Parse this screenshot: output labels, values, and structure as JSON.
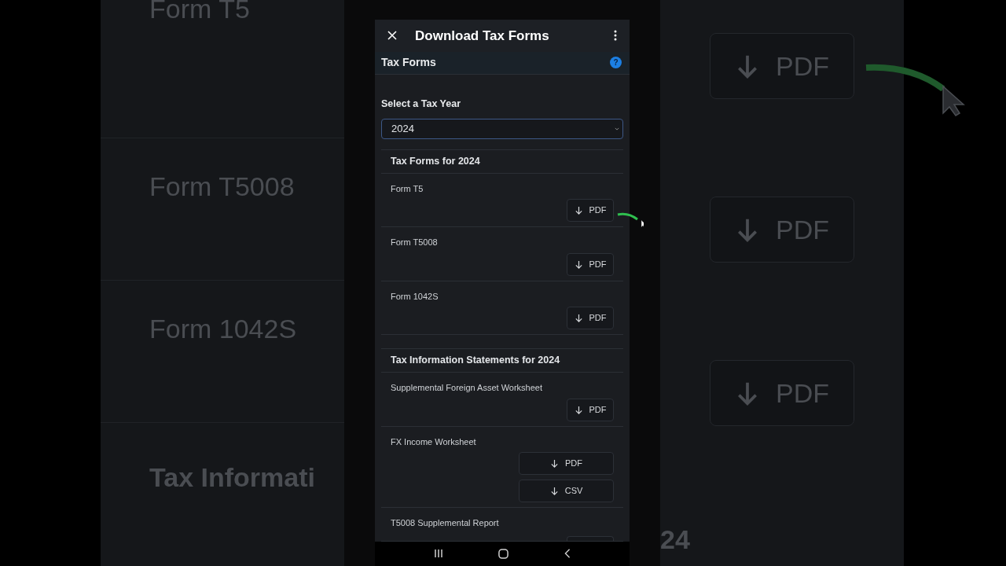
{
  "backdrop": {
    "left_texts": [
      "Form T5",
      "Form T5008",
      "Form 1042S",
      "Tax Informati"
    ],
    "right_buttons": [
      "PDF",
      "PDF",
      "PDF"
    ],
    "right_text": "24"
  },
  "header": {
    "title": "Download Tax Forms"
  },
  "section_bar": {
    "title": "Tax Forms",
    "help": "?"
  },
  "year_select": {
    "label": "Select a Tax Year",
    "value": "2024"
  },
  "groups": [
    {
      "title": "Tax Forms for 2024",
      "items": [
        {
          "name": "Form T5",
          "buttons": [
            {
              "label": "PDF"
            }
          ]
        },
        {
          "name": "Form T5008",
          "buttons": [
            {
              "label": "PDF"
            }
          ]
        },
        {
          "name": "Form 1042S",
          "buttons": [
            {
              "label": "PDF"
            }
          ]
        }
      ]
    },
    {
      "title": "Tax Information Statements for 2024",
      "items": [
        {
          "name": "Supplemental Foreign Asset Worksheet",
          "buttons": [
            {
              "label": "PDF"
            }
          ]
        },
        {
          "name": "FX Income Worksheet",
          "wide": true,
          "buttons": [
            {
              "label": "PDF"
            },
            {
              "label": "CSV"
            }
          ]
        },
        {
          "name": "T5008 Supplemental Report",
          "cut": true
        }
      ]
    }
  ]
}
